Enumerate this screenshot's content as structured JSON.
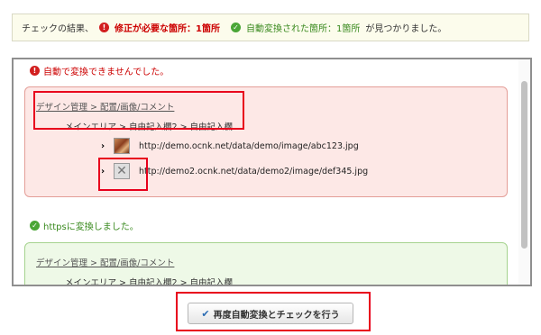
{
  "summary": {
    "intro": "チェックの結果、",
    "error_icon": "exclamation-circle-icon",
    "error_text": "修正が必要な箇所：1箇所",
    "ok_icon": "check-circle-icon",
    "ok_text": "自動変換された箇所：1箇所",
    "outro": "が見つかりました。"
  },
  "error_section": {
    "title": "自動で変換できませんでした。",
    "breadcrumb": "デザイン管理 > 配置/画像/コメント",
    "sub_breadcrumb": "メインエリア > 自由記入欄2 > 自由記入欄",
    "items": [
      {
        "thumbnail": "photo",
        "url": "http://demo.ocnk.net/data/demo/image/abc123.jpg"
      },
      {
        "thumbnail": "broken-image",
        "url": "http://demo2.ocnk.net/data/demo2/image/def345.jpg"
      }
    ]
  },
  "success_section": {
    "title": "httpsに変換しました。",
    "breadcrumb": "デザイン管理 > 配置/画像/コメント",
    "sub_breadcrumb": "メインエリア > 自由記入欄2 > 自由記入欄"
  },
  "action_button": {
    "icon": "check-icon",
    "label": "再度自動変換とチェックを行う"
  },
  "colors": {
    "error": "#cc0000",
    "success": "#3a8a1f",
    "highlight": "#e8001c"
  }
}
